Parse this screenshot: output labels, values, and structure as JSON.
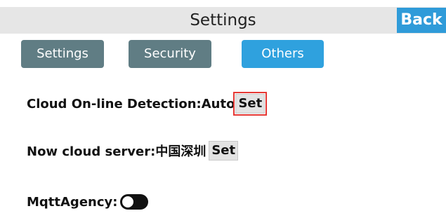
{
  "header": {
    "title": "Settings",
    "back_label": "Back"
  },
  "tabs": [
    {
      "label": "Settings",
      "active": false
    },
    {
      "label": "Security",
      "active": false
    },
    {
      "label": "Others",
      "active": true
    }
  ],
  "cloud_detection": {
    "label": "Cloud On-line Detection:Auto",
    "button": "Set"
  },
  "cloud_server": {
    "label": "Now cloud server:中国深圳",
    "button": "Set"
  },
  "mqtt_agency": {
    "label": "MqttAgency:",
    "enabled": false
  },
  "colors": {
    "header_bg": "#e6e6e6",
    "back_button": "#2f9bd9",
    "tab_inactive": "#607d84",
    "tab_active": "#2fa1de",
    "highlight": "#e53935"
  }
}
